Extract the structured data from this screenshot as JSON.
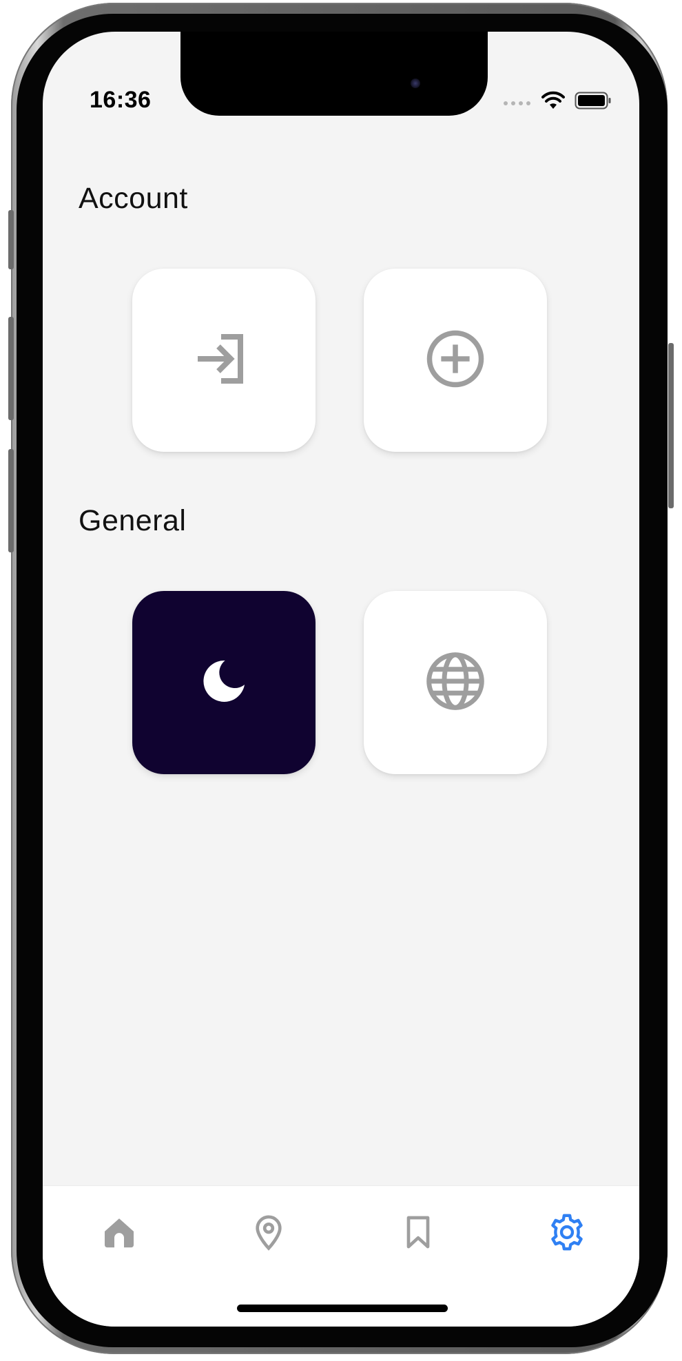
{
  "status_bar": {
    "time": "16:36"
  },
  "sections": {
    "account": {
      "title": "Account",
      "tiles": [
        {
          "icon": "login-icon"
        },
        {
          "icon": "add-circle-icon"
        }
      ]
    },
    "general": {
      "title": "General",
      "tiles": [
        {
          "icon": "moon-icon",
          "selected": true
        },
        {
          "icon": "globe-icon"
        }
      ]
    }
  },
  "tabbar": {
    "tabs": [
      {
        "icon": "home-icon",
        "active": false
      },
      {
        "icon": "location-pin-icon",
        "active": false
      },
      {
        "icon": "bookmark-icon",
        "active": false
      },
      {
        "icon": "gear-icon",
        "active": true
      }
    ]
  },
  "colors": {
    "background": "#f4f4f4",
    "tile": "#ffffff",
    "dark_tile": "#100330",
    "icon_gray": "#9e9e9e",
    "active_tab": "#2f80f3"
  }
}
